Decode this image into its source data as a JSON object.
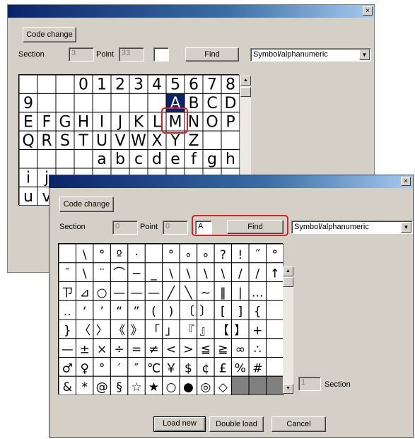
{
  "win1": {
    "close_label": "×",
    "code_change_label": "Code change",
    "section_label": "Section",
    "section_value": "3",
    "point_label": "Point",
    "point_value": "33",
    "search_value": "",
    "find_label": "Find",
    "charset_selected": "Symbol/alphanumeric",
    "grid_rows": [
      [
        "",
        "",
        "",
        "0",
        "1",
        "2",
        "3",
        "4",
        "5",
        "6",
        "7",
        "8"
      ],
      [
        "9",
        "",
        "",
        "",
        "",
        "",
        "",
        "",
        "A",
        "B",
        "C",
        "D"
      ],
      [
        "E",
        "F",
        "G",
        "H",
        "I",
        "J",
        "K",
        "L",
        "M",
        "N",
        "O",
        "P"
      ],
      [
        "Q",
        "R",
        "S",
        "T",
        "U",
        "V",
        "W",
        "X",
        "Y",
        "Z",
        "",
        ""
      ],
      [
        "",
        "",
        "",
        "",
        "a",
        "b",
        "c",
        "d",
        "e",
        "f",
        "g",
        "h"
      ],
      [
        "i",
        "j",
        "",
        "",
        "",
        "",
        "",
        "",
        "",
        "",
        "",
        ""
      ],
      [
        "u",
        "v",
        "",
        "",
        "",
        "",
        "",
        "",
        "",
        "",
        "",
        ""
      ]
    ],
    "selected_char": "A"
  },
  "win2": {
    "close_label": "×",
    "code_change_label": "Code change",
    "section_label": "Section",
    "section_value": "0",
    "point_label": "Point",
    "point_value": "0",
    "search_value": "A",
    "find_label": "Find",
    "charset_selected": "Symbol/alphanumeric",
    "grid_rows": [
      [
        "",
        "\\",
        "°",
        "º",
        "·",
        "",
        "°",
        "∘",
        "∘",
        "?",
        "!",
        "˝",
        "°"
      ],
      [
        "¯",
        "\\",
        "¨",
        "⌒",
        "─",
        "_",
        "\\",
        "\\",
        "\\",
        "\\",
        "/",
        "/",
        "↑"
      ],
      [
        "ㄗ",
        "⊿",
        "○",
        "—",
        "—",
        "—",
        "╱",
        "╲",
        "~",
        "‖",
        "|",
        "…",
        ""
      ],
      [
        "..",
        "‘",
        "’",
        "“",
        "”",
        "(",
        ")",
        "〔",
        "〕",
        "[",
        "]",
        "{",
        ""
      ],
      [
        "}",
        "〈",
        "〉",
        "《",
        "》",
        "「",
        "」",
        "『",
        "』",
        "【",
        "】",
        "+",
        ""
      ],
      [
        "—",
        "±",
        "×",
        "÷",
        "=",
        "≠",
        "<",
        ">",
        "≦",
        "≧",
        "∞",
        "∴",
        ""
      ],
      [
        "♂",
        "♀",
        "°",
        "′",
        "″",
        "℃",
        "￥",
        "$",
        "¢",
        "£",
        "%",
        "#",
        ""
      ],
      [
        "&",
        "*",
        "@",
        "§",
        "☆",
        "★",
        "○",
        "●",
        "◎",
        "◇",
        "",
        "",
        ""
      ]
    ],
    "section_readout_value": "1",
    "section_readout_label": "Section",
    "load_new_label": "Load new",
    "double_load_label": "Double load",
    "cancel_label": "Cancel"
  },
  "accent": {
    "highlight": "#d5232a",
    "title_dark": "#0a246a",
    "selection": "#0a246a",
    "window_face": "#d4d0c8"
  },
  "icons": {
    "close": "close-icon",
    "dropdown": "chevron-down-icon",
    "scroll_up": "scroll-up-arrow-icon",
    "scroll_down": "scroll-down-arrow-icon"
  }
}
